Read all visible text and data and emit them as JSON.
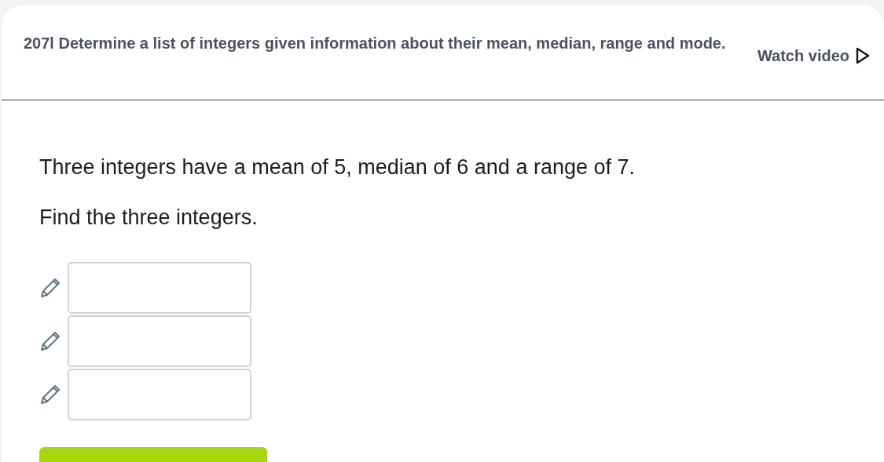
{
  "header": {
    "title": "207l Determine a list of integers given information about their mean, median, range and mode.",
    "video_link": "Watch video"
  },
  "question": {
    "paragraphs": [
      "Three integers have a mean of 5, median of 6 and a range of 7.",
      "Find the three integers."
    ]
  },
  "answers": [
    {
      "kind": "input"
    },
    {
      "kind": "input"
    },
    {
      "kind": "input"
    }
  ]
}
